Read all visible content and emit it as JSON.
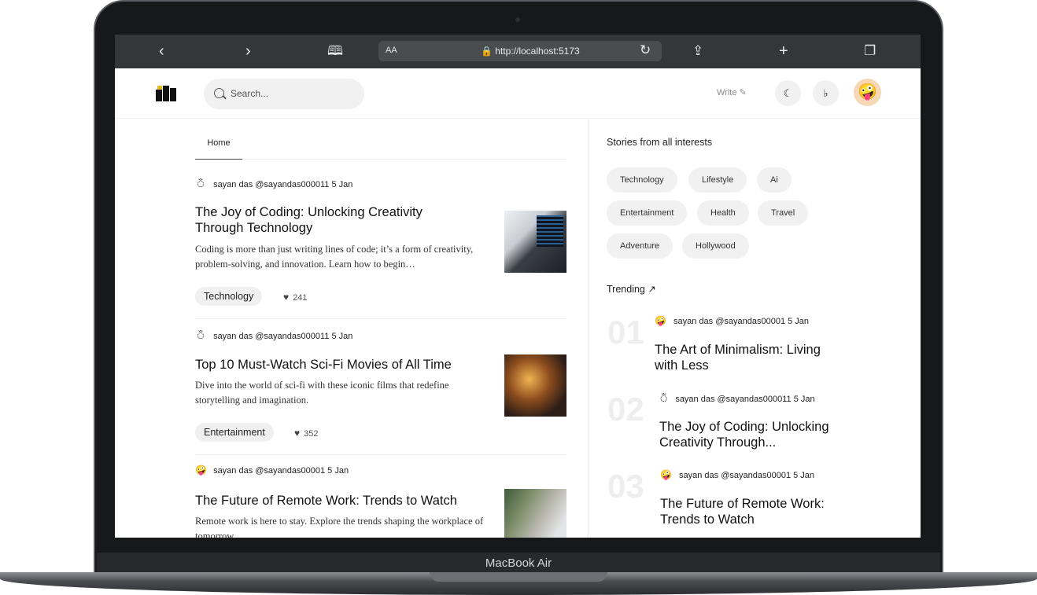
{
  "device": {
    "label": "MacBook Air"
  },
  "browser": {
    "text_size_label": "AA",
    "url": "http://localhost:5173"
  },
  "header": {
    "search_placeholder": "Search...",
    "write_label": "Write"
  },
  "feed": {
    "tab_home": "Home",
    "posts": [
      {
        "author": "sayan das @sayandas000011",
        "date": "5 Jan",
        "title": "The Joy of Coding: Unlocking Creativity Through Technology",
        "description": "Coding is more than just writing lines of code; it’s a form of creativity, problem-solving, and innovation. Learn how to begin…",
        "tag": "Technology",
        "likes": "241"
      },
      {
        "author": "sayan das @sayandas000011",
        "date": "5 Jan",
        "title": "Top 10 Must-Watch Sci-Fi Movies of All Time",
        "description": "Dive into the world of sci-fi with these iconic films that redefine storytelling and imagination.",
        "tag": "Entertainment",
        "likes": "352"
      },
      {
        "author": "sayan das @sayandas00001",
        "date": "5 Jan",
        "title": "The Future of Remote Work: Trends to Watch",
        "description": "Remote work is here to stay. Explore the trends shaping the workplace of tomorrow."
      }
    ]
  },
  "sidebar": {
    "interests_title": "Stories from all interests",
    "interests": [
      "Technology",
      "Lifestyle",
      "Ai",
      "Entertainment",
      "Health",
      "Travel",
      "Adventure",
      "Hollywood"
    ],
    "trending_title": "Trending",
    "trending": [
      {
        "rank": "01",
        "author": "sayan das @sayandas00001",
        "date": "5 Jan",
        "title": "The Art of Minimalism: Living with Less"
      },
      {
        "rank": "02",
        "author": "sayan das @sayandas000011",
        "date": "5 Jan",
        "title": "The Joy of Coding: Unlocking Creativity Through..."
      },
      {
        "rank": "03",
        "author": "sayan das @sayandas00001",
        "date": "5 Jan",
        "title": "The Future of Remote Work: Trends to Watch"
      }
    ]
  },
  "icons": {
    "back": "chevron-left-icon",
    "forward": "chevron-right-icon",
    "bookmarks": "book-icon",
    "lock": "lock-icon",
    "reload": "reload-icon",
    "share": "share-icon",
    "new_tab": "plus-icon",
    "tabs": "tabs-icon",
    "write": "edit-icon",
    "theme": "theme-toggle-icon",
    "notifications": "bell-icon",
    "like": "heart-icon",
    "trending": "trending-icon"
  }
}
